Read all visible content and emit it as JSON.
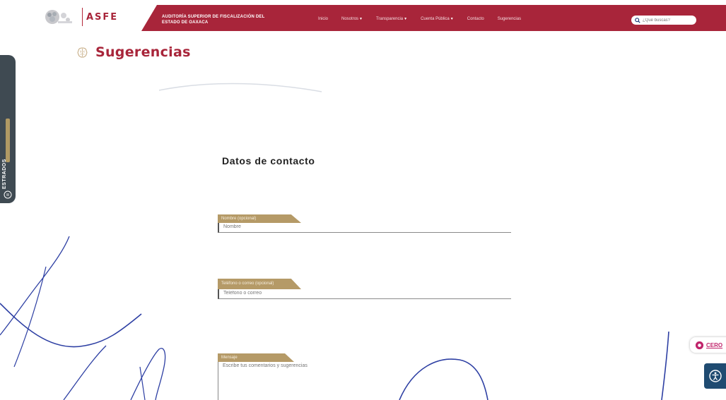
{
  "header": {
    "logo_text": "ASFE",
    "org_name": "AUDITORÍA SUPERIOR DE FISCALIZACIÓN DEL ESTADO DE OAXACA",
    "colors": {
      "brand": "#a8253a",
      "gold": "#b59a67"
    },
    "nav": [
      {
        "label": "Inicio",
        "has_caret": false
      },
      {
        "label": "Nosotros",
        "has_caret": true
      },
      {
        "label": "Transparencia",
        "has_caret": true
      },
      {
        "label": "Cuenta Pública",
        "has_caret": true
      },
      {
        "label": "Contacto",
        "has_caret": false
      },
      {
        "label": "Sugerencias",
        "has_caret": false
      }
    ],
    "search_placeholder": "¿Qué buscas?"
  },
  "page": {
    "title": "Sugerencias",
    "title_icon": "brain-icon"
  },
  "side_tab": {
    "label": "ESTRADOS",
    "icon": "list-icon"
  },
  "form": {
    "heading": "Datos de contacto",
    "fields": [
      {
        "label": "Nombre (opcional)",
        "placeholder": "Nombre"
      },
      {
        "label": "Teléfono o correo (opcional)",
        "placeholder": "Teléfono o correo"
      },
      {
        "label": "Mensaje",
        "placeholder": "Escribe tus comentarios y sugerencias"
      }
    ]
  },
  "widgets": {
    "cero_label": "CERO",
    "accessibility_icon": "accessibility-icon"
  }
}
